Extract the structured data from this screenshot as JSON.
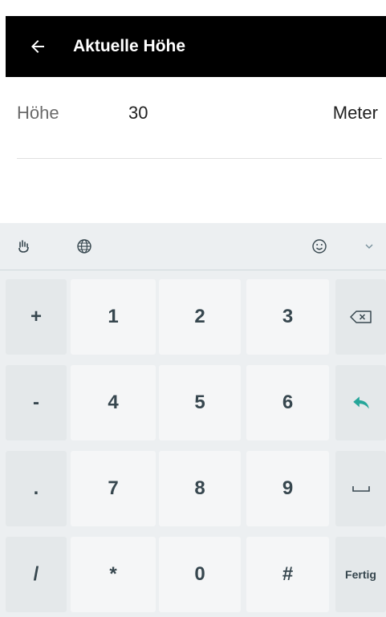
{
  "appbar": {
    "back_icon": "arrow-left-icon",
    "title": "Aktuelle Höhe"
  },
  "field": {
    "label": "Höhe",
    "value": "30",
    "unit": "Meter"
  },
  "keyboard": {
    "toolbar_icons": [
      "gesture-hand-icon",
      "globe-icon",
      "emoji-icon",
      "chevron-down-icon"
    ],
    "keys": {
      "plus": "+",
      "minus": "-",
      "dot": ".",
      "slash": "/",
      "k1": "1",
      "k2": "2",
      "k3": "3",
      "k4": "4",
      "k5": "5",
      "k6": "6",
      "k7": "7",
      "k8": "8",
      "k9": "9",
      "star": "*",
      "k0": "0",
      "hash": "#",
      "done": "Fertig"
    },
    "accent_color": "#26a69a"
  }
}
